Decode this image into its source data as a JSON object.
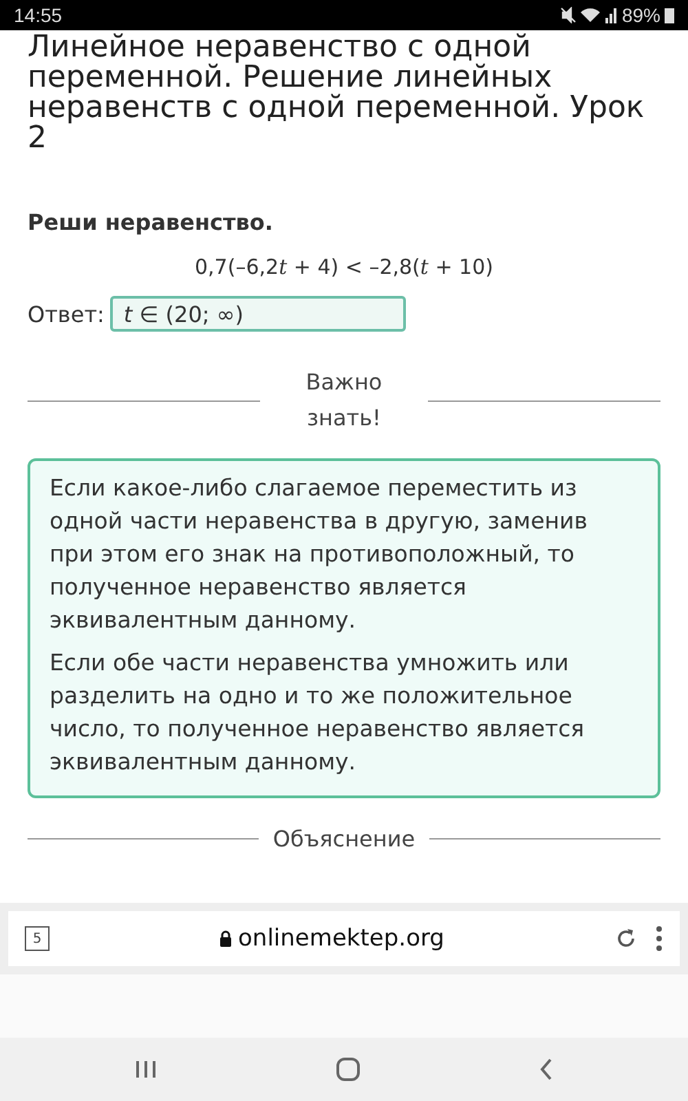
{
  "status_bar": {
    "time": "14:55",
    "battery": "89%"
  },
  "lesson_title": "Линейное неравенство с одной переменной. Решение линейных неравенств с одной переменной. Урок 2",
  "task": {
    "prompt": "Реши неравенство.",
    "equation": [
      {
        "text": "0,7(–6,2",
        "italic": false
      },
      {
        "text": "t",
        "italic": true
      },
      {
        "text": " + 4) < –2,8(",
        "italic": false
      },
      {
        "text": "t",
        "italic": true
      },
      {
        "text": " + 10)",
        "italic": false
      }
    ],
    "answer_label": "Ответ:",
    "answer_value": "*t* ∈ (20; ∞)"
  },
  "important": {
    "heading": "Важно знать!",
    "paragraphs": [
      "Если какое-либо слагаемое переместить из одной части неравенства в другую, заменив при этом его знак на противоположный, то полученное неравенство является эквивалентным данному.",
      "Если обе части неравенства умножить или разделить на одно и то же положительное число, то полученное неравенство является эквивалентным данному."
    ]
  },
  "explanation_heading": "Объяснение",
  "browser": {
    "tab_count": "5",
    "url": "onlinemektep.org"
  }
}
